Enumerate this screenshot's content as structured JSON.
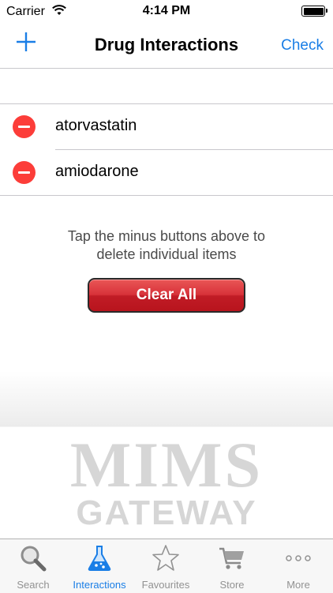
{
  "status_bar": {
    "carrier": "Carrier",
    "time": "4:14 PM"
  },
  "navbar": {
    "title": "Drug Interactions",
    "check_label": "Check",
    "add_icon": "plus-icon"
  },
  "items": [
    {
      "label": "atorvastatin",
      "icon": "minus-circle-icon"
    },
    {
      "label": "amiodarone",
      "icon": "minus-circle-icon"
    }
  ],
  "hint": {
    "line1": "Tap the minus buttons above to",
    "line2": "delete individual items"
  },
  "clear_all_label": "Clear All",
  "logo": {
    "line1": "MIMS",
    "line2": "GATEWAY"
  },
  "tabs": [
    {
      "label": "Search",
      "icon": "magnifier-icon"
    },
    {
      "label": "Interactions",
      "icon": "flask-icon",
      "active": true
    },
    {
      "label": "Favourites",
      "icon": "star-icon"
    },
    {
      "label": "Store",
      "icon": "cart-icon"
    },
    {
      "label": "More",
      "icon": "more-icon"
    }
  ],
  "colors": {
    "accent": "#1a7ee6",
    "delete": "#fc3d39",
    "button_red": "#d8323a",
    "tab_inactive": "#929292"
  }
}
